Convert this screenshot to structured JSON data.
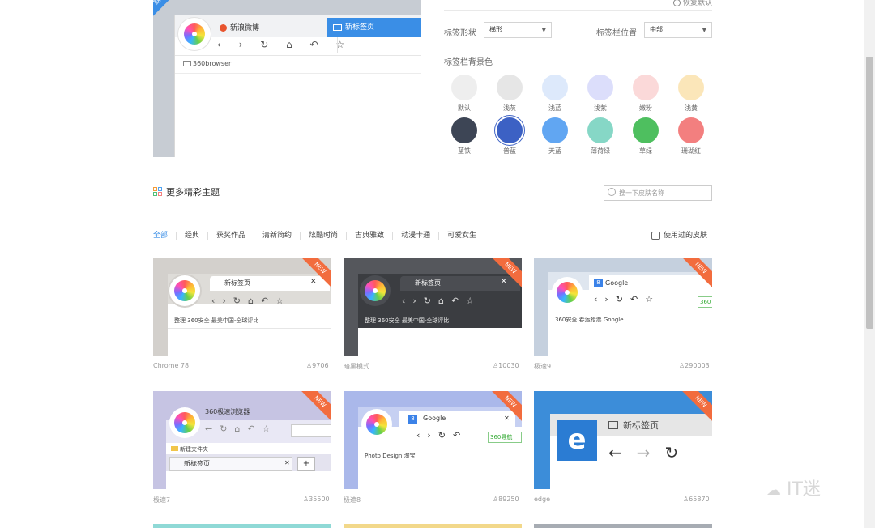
{
  "preview": {
    "corner_label": "默认",
    "tab1": "新浪微博",
    "tab2": "新标签页",
    "nav": "‹ › ↻ ⌂ ↶ ☆",
    "bookmark": "360browser"
  },
  "settings": {
    "radio_label": "恢复默认",
    "tab_shape_label": "标签形状",
    "tab_shape_value": "梯形",
    "tab_pos_label": "标签栏位置",
    "tab_pos_value": "中部",
    "bg_label": "标签栏背景色",
    "colors": [
      {
        "name": "默认",
        "hex": "#eeeeee"
      },
      {
        "name": "浅灰",
        "hex": "#e6e6e6"
      },
      {
        "name": "浅蓝",
        "hex": "#dde9fb"
      },
      {
        "name": "浅紫",
        "hex": "#dcdefb"
      },
      {
        "name": "嫩粉",
        "hex": "#fbd9d9"
      },
      {
        "name": "浅黄",
        "hex": "#fbe6b9"
      },
      {
        "name": "蓝铁",
        "hex": "#3d4555"
      },
      {
        "name": "普蓝",
        "hex": "#3c61c4"
      },
      {
        "name": "天蓝",
        "hex": "#61a6f2"
      },
      {
        "name": "薄荷绿",
        "hex": "#86d7c6"
      },
      {
        "name": "草绿",
        "hex": "#4ebf5f"
      },
      {
        "name": "珊瑚红",
        "hex": "#f37f7f"
      }
    ]
  },
  "section": {
    "title": "更多精彩主题",
    "search_placeholder": "搜一下皮肤名称",
    "categories": [
      "全部",
      "经典",
      "获奖作品",
      "清新简约",
      "炫酷时尚",
      "古典雅致",
      "动漫卡通",
      "可爱女生"
    ],
    "used_skins": "使用过的皮肤"
  },
  "cards": [
    {
      "name": "Chrome 78",
      "count": "9706",
      "badge": "NEW",
      "tab": "新标签页",
      "bm1": "整理",
      "bm2": "360安全",
      "bm3": "最美中国-全球评比"
    },
    {
      "name": "暗黑模式",
      "count": "10030",
      "badge": "NEW",
      "tab": "新标签页",
      "bm1": "整理",
      "bm2": "360安全",
      "bm3": "最美中国-全球评比"
    },
    {
      "name": "极速9",
      "count": "290003",
      "badge": "NEW",
      "tab": "Google",
      "bm1": "360安全",
      "bm2": "春运抢票",
      "bm3": "Google",
      "addr": "360"
    },
    {
      "name": "极速7",
      "count": "35500",
      "badge": "NEW",
      "tab": "新标签页",
      "title": "360极速浏览器",
      "bm1": "新建文件夹"
    },
    {
      "name": "极速8",
      "count": "89250",
      "badge": "NEW",
      "tab": "Google",
      "bm1": "Photo",
      "bm2": "Design",
      "bm3": "淘宝",
      "addr": "360导航"
    },
    {
      "name": "edge",
      "count": "65870",
      "badge": "NEW",
      "tab": "新标签页"
    }
  ],
  "watermark": "IT迷"
}
